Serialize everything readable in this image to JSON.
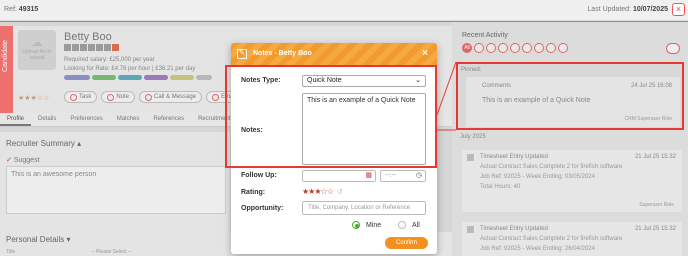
{
  "header": {
    "ref_label": "Ref:",
    "ref_value": "49315",
    "updated_label": "Last Updated:",
    "updated_value": "10/07/2025",
    "close_icon": "x-icon"
  },
  "candidate": {
    "name": "Betty Boo",
    "side_tab": "Candidate",
    "upload": "Upload file to upload",
    "salary": "Required salary: £25,000 per year",
    "looking": "Looking for Rate: £4.78 per hour | £36.21 per day",
    "actions": [
      "Task",
      "Note",
      "Call & Message",
      "Email"
    ],
    "stars": "★★★☆☆"
  },
  "tabs": [
    "Profile",
    "Details",
    "Preferences",
    "Matches",
    "References",
    "Recruitment"
  ],
  "recruiter_summary": {
    "title": "Recruiter Summary ▴",
    "suggest": "Suggest",
    "text": "This is an awesome person"
  },
  "personal_details": {
    "title": "Personal Details ▾",
    "fields": [
      "Title",
      "-- Please Select --"
    ]
  },
  "recent_activity": {
    "title": "Recent Activity",
    "filter_all": "All",
    "pinned_label": "Pinned:",
    "pinned": {
      "type": "Comments",
      "date": "24 Jul 25 16:08",
      "body": "This is an example of a Quick Note",
      "user": "CRM Superuser Role"
    },
    "month": "July 2025",
    "feed": [
      {
        "type": "Timesheet Entry Updated",
        "date": "21 Jul 25 15:32",
        "line1": "Actual Contract Sales Complete 2 for firefish software",
        "line2": "Job Ref: 92025 - Week Ending: 03/05/2024",
        "line3": "Total Hours: 40",
        "user": "Superuser Role"
      },
      {
        "type": "Timesheet Entry Updated",
        "date": "21 Jul 25 15:32",
        "line1": "Actual Contract Sales Complete 2 for firefish software",
        "line2": "Job Ref: 92025 - Week Ending: 26/04/2024"
      }
    ]
  },
  "modal": {
    "title": "Notes - Betty Boo",
    "notes_type_label": "Notes Type:",
    "notes_type_value": "Quick Note",
    "notes_label": "Notes:",
    "notes_value": "This is an example of a Quick Note",
    "follow_up_label": "Follow Up:",
    "time_placeholder": "--:--",
    "rating_label": "Rating:",
    "rating_stars": "★★★",
    "rating_empty": "☆☆",
    "opportunity_label": "Opportunity:",
    "opportunity_placeholder": "Title, Company, Location or Reference",
    "mine_label": "Mine",
    "all_label": "All",
    "confirm_label": "Confirm"
  },
  "colors": {
    "accent": "#f39021",
    "highlight": "#e53935",
    "radio": "#49b02b"
  }
}
